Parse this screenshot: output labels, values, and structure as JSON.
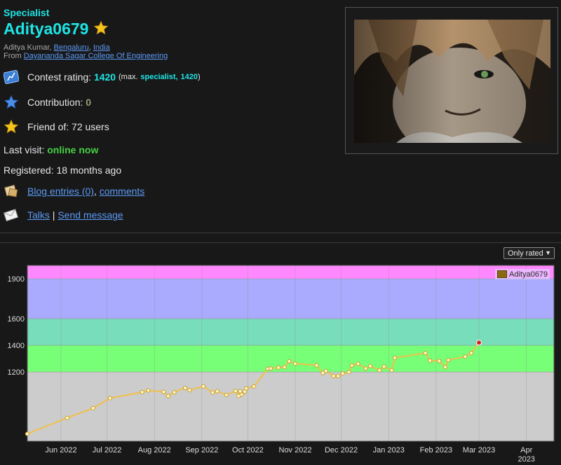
{
  "profile": {
    "rank": "Specialist",
    "handle": "Aditya0679",
    "name": "Aditya Kumar",
    "city": "Bengaluru",
    "country": "India",
    "from_label": "From",
    "organization": "Dayananda Sagar College Of Engineering",
    "contest_rating_label": "Contest rating:",
    "rating": "1420",
    "max_prefix": "(max.",
    "max_rank": "specialist,",
    "max_rating": "1420",
    "max_suffix": ")",
    "contribution_label": "Contribution:",
    "contribution": "0",
    "friend_of": "Friend of: 72 users",
    "last_visit_label": "Last visit:",
    "last_visit": "online now",
    "registered": "Registered: 18 months ago",
    "blog_entries": "Blog entries (0)",
    "comments": "comments",
    "talks": "Talks",
    "send_message": "Send message",
    "separator": "|"
  },
  "icons": {
    "rank_star": "star-icon",
    "rating": "rating-chart-icon",
    "contribution": "blue-star-icon",
    "friends": "gold-star-icon",
    "blog": "blog-icon",
    "message": "envelope-icon"
  },
  "colors": {
    "specialist": "#1ee4e4",
    "link": "#5b9af5",
    "online": "#45d145",
    "series": "#f0c04a"
  },
  "filter": {
    "selected": "Only rated"
  },
  "chart_data": {
    "type": "line",
    "ylim": [
      680,
      2000
    ],
    "y_ticks": [
      1200,
      1400,
      1600,
      1900
    ],
    "x_ticks": [
      "Jun 2022",
      "Jul 2022",
      "Aug 2022",
      "Sep 2022",
      "Oct 2022",
      "Nov 2022",
      "Dec 2022",
      "Jan 2023",
      "Feb 2023",
      "Mar 2023",
      "Apr 2023"
    ],
    "legend": "Aditya0679",
    "legend_position": "top-right",
    "bands": [
      {
        "from": 680,
        "to": 1200,
        "color": "#cccccc"
      },
      {
        "from": 1200,
        "to": 1400,
        "color": "#77ff77"
      },
      {
        "from": 1400,
        "to": 1600,
        "color": "#77ddbb"
      },
      {
        "from": 1600,
        "to": 1900,
        "color": "#aaaaff"
      },
      {
        "from": 1900,
        "to": 2000,
        "color": "#ff88ff"
      }
    ],
    "grid": true,
    "series": [
      {
        "name": "Aditya0679",
        "points": [
          [
            "2022-05-10",
            735
          ],
          [
            "2022-06-05",
            855
          ],
          [
            "2022-06-22",
            928
          ],
          [
            "2022-07-03",
            1003
          ],
          [
            "2022-07-24",
            1048
          ],
          [
            "2022-07-28",
            1061
          ],
          [
            "2022-08-07",
            1050
          ],
          [
            "2022-08-10",
            1019
          ],
          [
            "2022-08-14",
            1047
          ],
          [
            "2022-08-21",
            1080
          ],
          [
            "2022-08-24",
            1063
          ],
          [
            "2022-09-02",
            1091
          ],
          [
            "2022-09-08",
            1046
          ],
          [
            "2022-09-11",
            1055
          ],
          [
            "2022-09-17",
            1027
          ],
          [
            "2022-09-23",
            1057
          ],
          [
            "2022-09-25",
            1020
          ],
          [
            "2022-09-26",
            1055
          ],
          [
            "2022-09-27",
            1030
          ],
          [
            "2022-09-29",
            1052
          ],
          [
            "2022-09-30",
            1076
          ],
          [
            "2022-10-05",
            1091
          ],
          [
            "2022-10-14",
            1224
          ],
          [
            "2022-10-16",
            1226
          ],
          [
            "2022-10-21",
            1233
          ],
          [
            "2022-10-25",
            1236
          ],
          [
            "2022-10-28",
            1280
          ],
          [
            "2022-11-01",
            1262
          ],
          [
            "2022-11-15",
            1250
          ],
          [
            "2022-11-19",
            1192
          ],
          [
            "2022-11-21",
            1207
          ],
          [
            "2022-11-26",
            1169
          ],
          [
            "2022-11-29",
            1169
          ],
          [
            "2022-12-02",
            1189
          ],
          [
            "2022-12-06",
            1199
          ],
          [
            "2022-12-08",
            1249
          ],
          [
            "2022-12-12",
            1261
          ],
          [
            "2022-12-17",
            1226
          ],
          [
            "2022-12-20",
            1244
          ],
          [
            "2022-12-26",
            1213
          ],
          [
            "2022-12-29",
            1240
          ],
          [
            "2023-01-03",
            1213
          ],
          [
            "2023-01-05",
            1306
          ],
          [
            "2023-01-25",
            1342
          ],
          [
            "2023-01-28",
            1285
          ],
          [
            "2023-02-03",
            1283
          ],
          [
            "2023-02-07",
            1236
          ],
          [
            "2023-02-09",
            1289
          ],
          [
            "2023-02-20",
            1315
          ],
          [
            "2023-02-24",
            1342
          ],
          [
            "2023-03-01",
            1420
          ]
        ]
      }
    ]
  }
}
